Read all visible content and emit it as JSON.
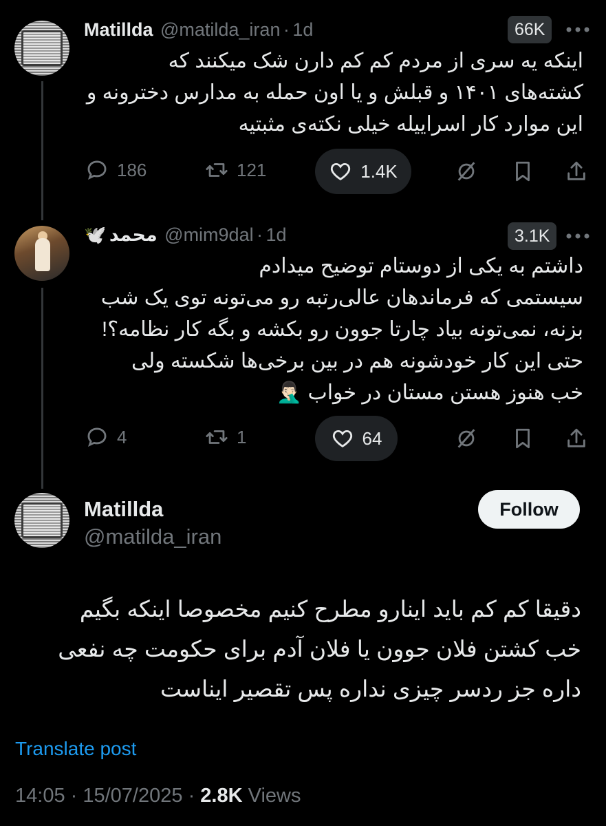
{
  "tweets": [
    {
      "name": "Matillda",
      "handle": "@matilda_iran",
      "age": "1d",
      "views": "66K",
      "text": "اینکه یه سری از مردم کم کم دارن شک میکنند که\nکشته‌های ۱۴۰۱ و قبلش و یا اون حمله به مدارس دخترونه و\nاین موارد کار اسراییله خیلی نکته‌ی مثبتیه",
      "replies": "186",
      "reposts": "121",
      "likes": "1.4K"
    },
    {
      "name": "محمد",
      "name_emoji": "🕊️",
      "handle": "@mim9dal",
      "age": "1d",
      "views": "3.1K",
      "text": "داشتم به یکی از دوستام توضیح میدادم\nسیستمی که فرماندهان عالی‌رتبه رو می‌تونه توی یک شب\nبزنه، نمی‌تونه بیاد چارتا جوون رو بکشه و بگه کار نظامه؟!\nحتی این کار خودشونه هم در بین برخی‌ها شکسته ولی\nخب هنوز هستن مستان در خواب 🤦🏻‍♂️",
      "replies": "4",
      "reposts": "1",
      "likes": "64"
    }
  ],
  "main": {
    "name": "Matillda",
    "handle": "@matilda_iran",
    "follow_label": "Follow",
    "text": "دقیقا کم کم باید اینارو مطرح کنیم مخصوصا اینکه بگیم\nخب کشتن فلان جوون یا فلان آدم برای حکومت چه نفعی\nداره جز ردسر چیزی نداره پس تقصیر ایناست",
    "translate_label": "Translate post",
    "time": "14:05",
    "date": "15/07/2025",
    "views_count": "2.8K",
    "views_label": "Views"
  },
  "icons": [
    "reply-icon",
    "repost-icon",
    "heart-icon",
    "grok-icon",
    "bookmark-icon",
    "share-icon",
    "more-icon"
  ],
  "colors": {
    "background": "#000000",
    "link": "#1d9bf0",
    "muted": "#71767b",
    "text": "#e7e9ea"
  }
}
